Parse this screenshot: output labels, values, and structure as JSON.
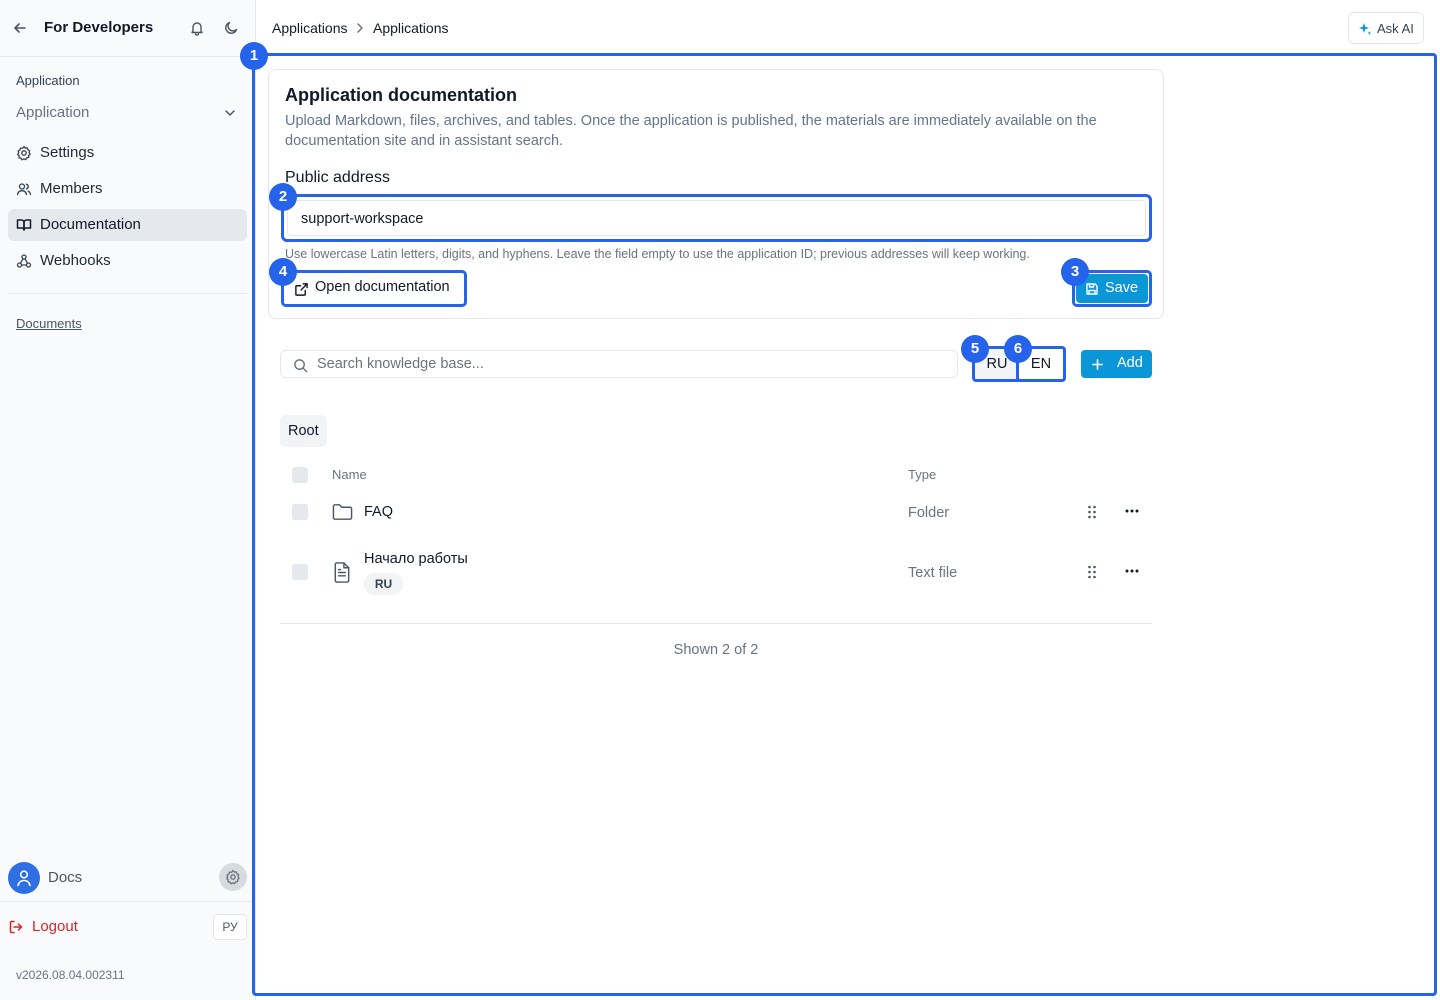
{
  "sidebar": {
    "title": "For Developers",
    "section_label": "Application",
    "select_value": "Application",
    "nav": [
      {
        "label": "Settings",
        "icon": "gear-icon"
      },
      {
        "label": "Members",
        "icon": "users-icon"
      },
      {
        "label": "Documentation",
        "icon": "book-icon",
        "active": true
      },
      {
        "label": "Webhooks",
        "icon": "webhook-icon"
      }
    ],
    "docs_link": "Documents",
    "user_name": "Docs",
    "logout_label": "Logout",
    "lang_label": "РУ",
    "version": "v2026.08.04.002311"
  },
  "topbar": {
    "breadcrumb": [
      "Applications",
      "Applications"
    ],
    "ask_ai_label": "Ask AI"
  },
  "annotations": [
    "1",
    "2",
    "3",
    "4",
    "5",
    "6"
  ],
  "card": {
    "title": "Application documentation",
    "description": "Upload Markdown, files, archives, and tables. Once the application is published, the materials are immediately available on the documentation site and in assistant search.",
    "field_label": "Public address",
    "field_value": "support-workspace",
    "hint": "Use lowercase Latin letters, digits, and hyphens. Leave the field empty to use the application ID; previous addresses will keep working.",
    "open_label": "Open documentation",
    "save_label": "Save"
  },
  "kb": {
    "search_placeholder": "Search knowledge base...",
    "lang_ru": "RU",
    "lang_en": "EN",
    "add_label": "Add",
    "root_label": "Root",
    "columns": {
      "name": "Name",
      "type": "Type"
    },
    "rows": [
      {
        "name": "FAQ",
        "type": "Folder",
        "icon": "folder-icon"
      },
      {
        "name": "Начало работы",
        "type": "Text file",
        "icon": "file-text-icon",
        "tag": "RU"
      }
    ],
    "shown_text": "Shown 2 of 2"
  },
  "colors": {
    "accent": "#2563eb",
    "primary_button": "#0b96d8",
    "danger": "#dc2626"
  }
}
